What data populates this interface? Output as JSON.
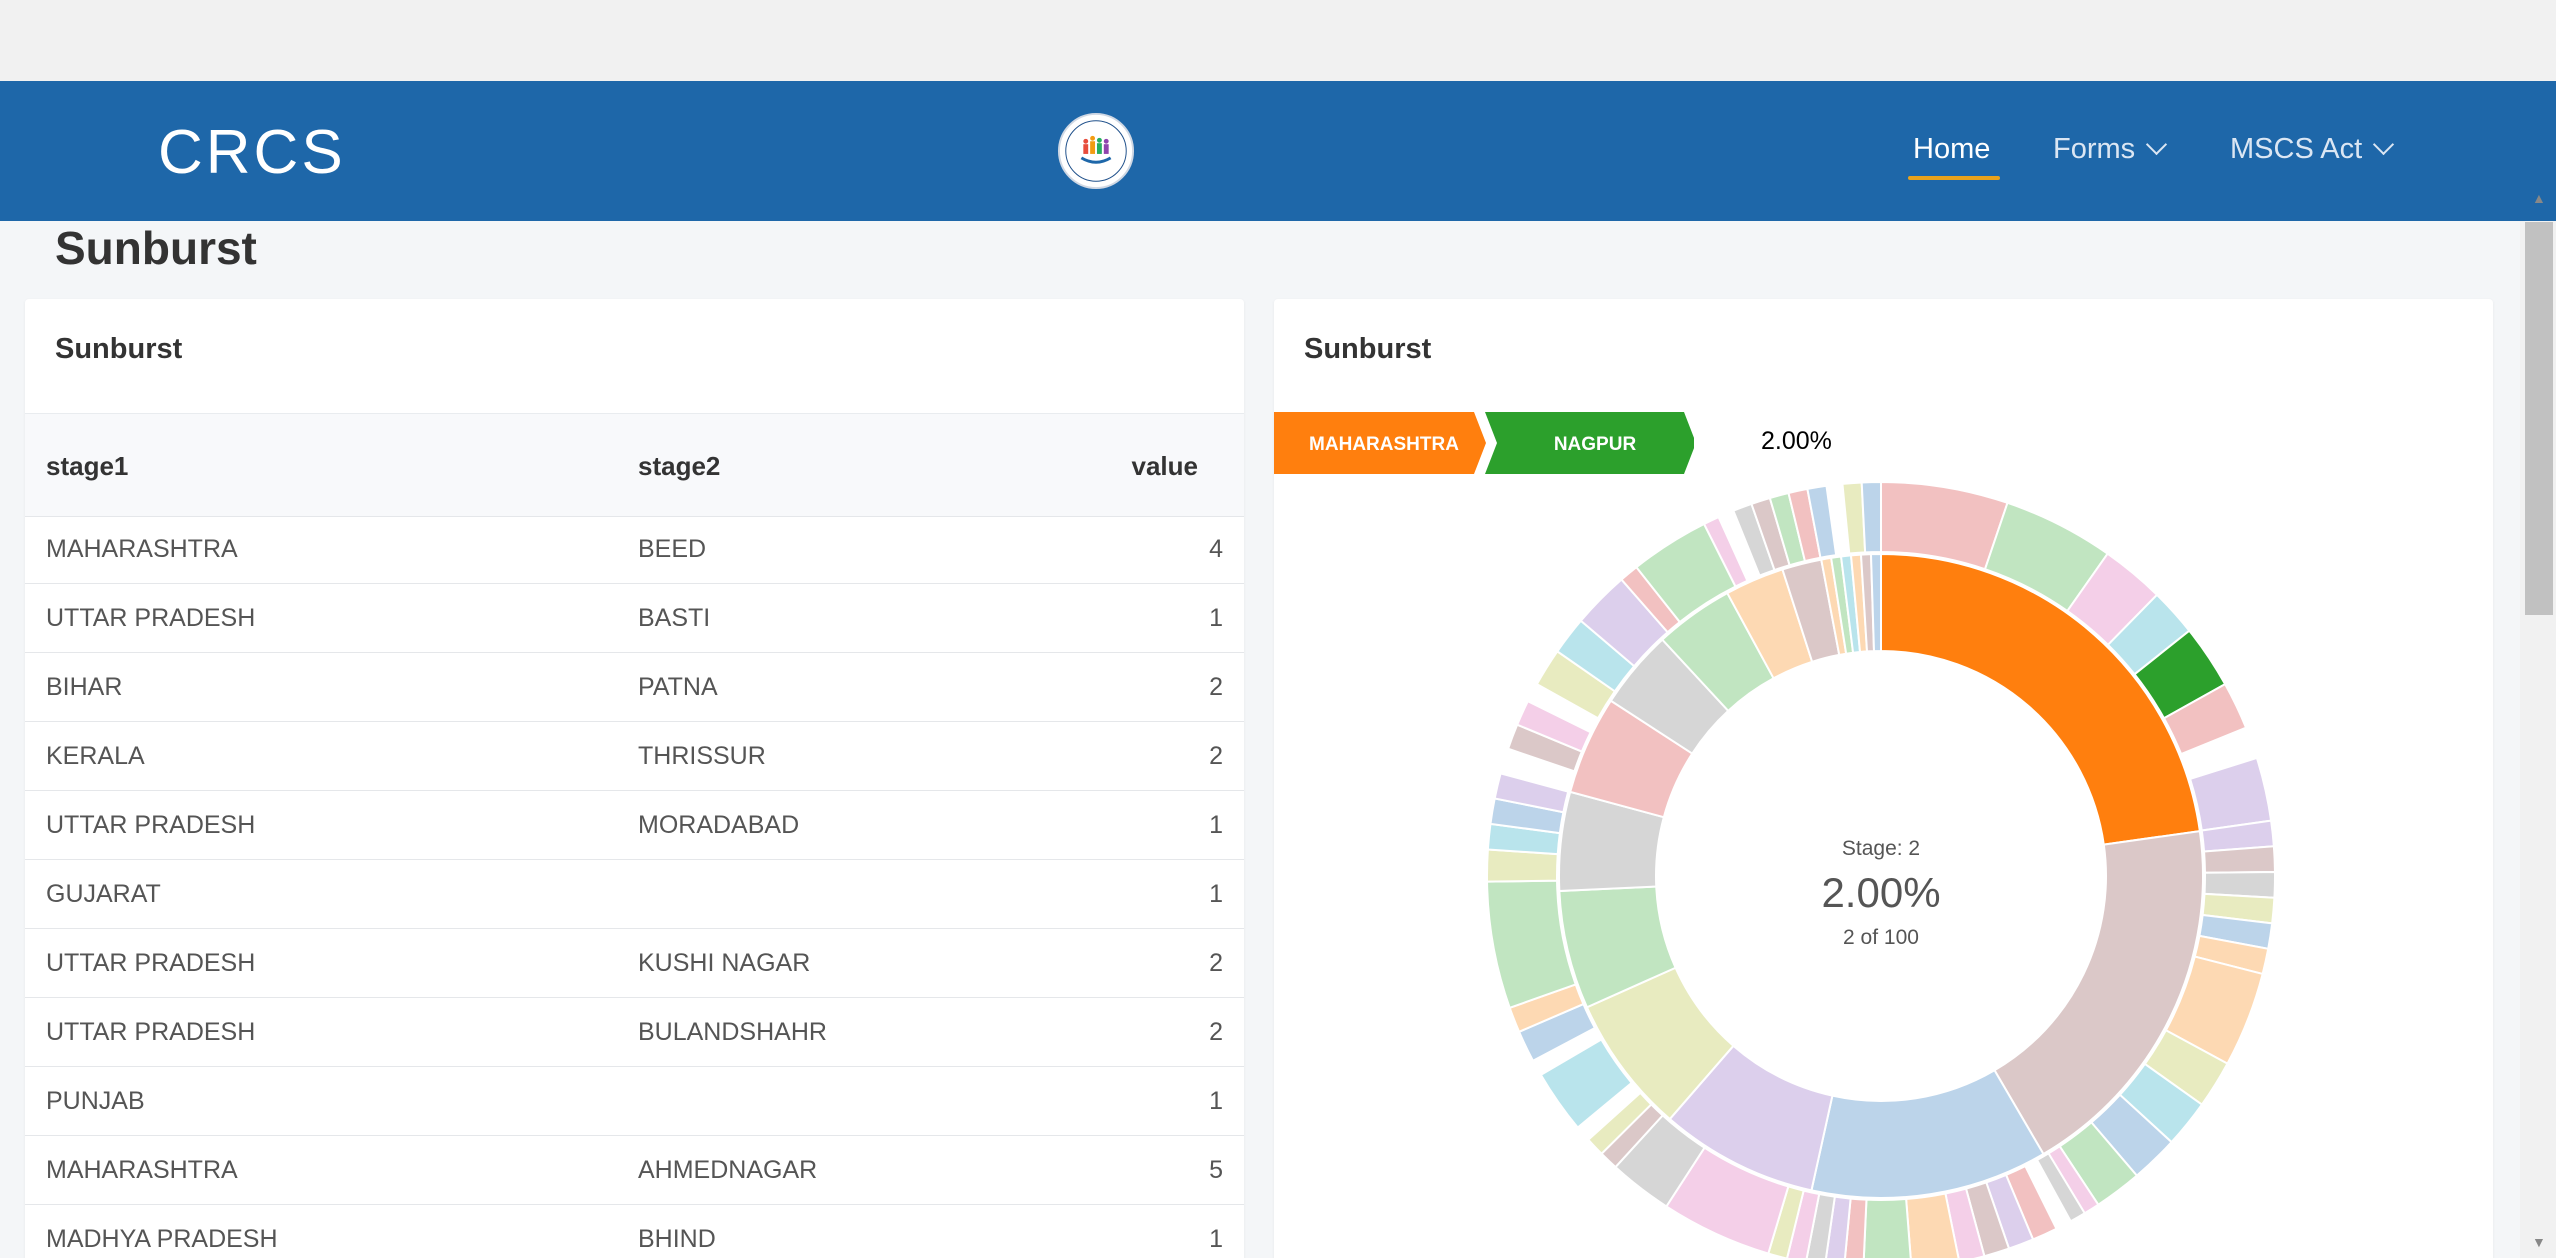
{
  "navbar": {
    "brand": "CRCS",
    "nav_items": [
      {
        "label": "Home",
        "active": true
      },
      {
        "label": "Forms",
        "dropdown": true
      },
      {
        "label": "MSCS Act",
        "dropdown": true
      }
    ]
  },
  "page": {
    "title": "Sunburst"
  },
  "table_card": {
    "title": "Sunburst",
    "columns": [
      "stage1",
      "stage2",
      "value"
    ],
    "rows": [
      [
        "MAHARASHTRA",
        "BEED",
        "4"
      ],
      [
        "UTTAR PRADESH",
        "BASTI",
        "1"
      ],
      [
        "BIHAR",
        "PATNA",
        "2"
      ],
      [
        "KERALA",
        "THRISSUR",
        "2"
      ],
      [
        "UTTAR PRADESH",
        "MORADABAD",
        "1"
      ],
      [
        "GUJARAT",
        "",
        "1"
      ],
      [
        "UTTAR PRADESH",
        "KUSHI NAGAR",
        "2"
      ],
      [
        "UTTAR PRADESH",
        "BULANDSHAHR",
        "2"
      ],
      [
        "PUNJAB",
        "",
        "1"
      ],
      [
        "MAHARASHTRA",
        "AHMEDNAGAR",
        "5"
      ],
      [
        "MADHYA PRADESH",
        "BHIND",
        "1"
      ]
    ]
  },
  "chart_card": {
    "title": "Sunburst",
    "breadcrumb": [
      "MAHARASHTRA",
      "NAGPUR"
    ],
    "breadcrumb_colors": [
      "#ff7f0e",
      "#2ca02c"
    ],
    "percentage": "2.00%",
    "center": {
      "stage": "Stage: 2",
      "percent": "2.00%",
      "count": "2 of 100"
    }
  },
  "chart_data": {
    "type": "sunburst",
    "total": 100,
    "selected": {
      "stage1": "MAHARASHTRA",
      "stage2": "NAGPUR",
      "value": 2
    },
    "inner_ring": [
      {
        "value": 23,
        "color": "#ff7f0e"
      },
      {
        "value": 19,
        "color": "#dbc8c8"
      },
      {
        "value": 12,
        "color": "#bcd4ea"
      },
      {
        "value": 8,
        "color": "#dccfec"
      },
      {
        "value": 7,
        "color": "#e8ebc0"
      },
      {
        "value": 6,
        "color": "#c1e5c1"
      },
      {
        "value": 5,
        "color": "#d6d6d6"
      },
      {
        "value": 5,
        "color": "#f2c1c1"
      },
      {
        "value": 4,
        "color": "#d6d6d6"
      },
      {
        "value": 4,
        "color": "#c1e5c1"
      },
      {
        "value": 3,
        "color": "#fdd9b3"
      },
      {
        "value": 2,
        "color": "#dbc8c8"
      },
      {
        "value": 0.5,
        "color": "#fdd9b3"
      },
      {
        "value": 0.5,
        "color": "#c1e5c1"
      },
      {
        "value": 0.5,
        "color": "#b9e4ec"
      },
      {
        "value": 0.5,
        "color": "#fdd9b3"
      },
      {
        "value": 0.5,
        "color": "#dbc8c8"
      },
      {
        "value": 0.5,
        "color": "#bcd4ea"
      }
    ],
    "outer_ring": [
      {
        "value": 4.0,
        "color": "#f2c1c1"
      },
      {
        "value": 3.5,
        "color": "#c1e5c1"
      },
      {
        "value": 2.0,
        "color": "#f4cfe8"
      },
      {
        "value": 1.5,
        "color": "#b9e4ec"
      },
      {
        "value": 2.0,
        "color": "#2ca02c"
      },
      {
        "value": 1.5,
        "color": "#f2c1c1"
      },
      {
        "value": 1.0,
        "color": null
      },
      {
        "value": 2.0,
        "color": "#dccfec"
      },
      {
        "value": 0.8,
        "color": "#dccfec"
      },
      {
        "value": 0.8,
        "color": "#dbc8c8"
      },
      {
        "value": 0.8,
        "color": "#d6d6d6"
      },
      {
        "value": 0.8,
        "color": "#e8ebc0"
      },
      {
        "value": 0.8,
        "color": "#bcd4ea"
      },
      {
        "value": 0.8,
        "color": "#fdd9b3"
      },
      {
        "value": 3.0,
        "color": "#fdd9b3"
      },
      {
        "value": 1.5,
        "color": "#e8ebc0"
      },
      {
        "value": 1.5,
        "color": "#b9e4ec"
      },
      {
        "value": 1.5,
        "color": "#bcd4ea"
      },
      {
        "value": 1.5,
        "color": "#c1e5c1"
      },
      {
        "value": 0.5,
        "color": "#f4cfe8"
      },
      {
        "value": 0.5,
        "color": "#d6d6d6"
      },
      {
        "value": 0.5,
        "color": null
      },
      {
        "value": 0.8,
        "color": "#f2c1c1"
      },
      {
        "value": 0.8,
        "color": "#dccfec"
      },
      {
        "value": 0.8,
        "color": "#dbc8c8"
      },
      {
        "value": 0.8,
        "color": "#f4cfe8"
      },
      {
        "value": 1.5,
        "color": "#fdd9b3"
      },
      {
        "value": 1.5,
        "color": "#c1e5c1"
      },
      {
        "value": 0.6,
        "color": "#f2c1c1"
      },
      {
        "value": 0.6,
        "color": "#dccfec"
      },
      {
        "value": 0.6,
        "color": "#d6d6d6"
      },
      {
        "value": 0.6,
        "color": "#f4cfe8"
      },
      {
        "value": 0.6,
        "color": "#e8ebc0"
      },
      {
        "value": 3.5,
        "color": "#f4cfe8"
      },
      {
        "value": 2.0,
        "color": "#d6d6d6"
      },
      {
        "value": 0.6,
        "color": "#dbc8c8"
      },
      {
        "value": 0.6,
        "color": "#e8ebc0"
      },
      {
        "value": 0.5,
        "color": null
      },
      {
        "value": 2.0,
        "color": "#b9e4ec"
      },
      {
        "value": 0.5,
        "color": null
      },
      {
        "value": 1.0,
        "color": "#bcd4ea"
      },
      {
        "value": 0.8,
        "color": "#fdd9b3"
      },
      {
        "value": 4.0,
        "color": "#c1e5c1"
      },
      {
        "value": 1.0,
        "color": "#e8ebc0"
      },
      {
        "value": 0.8,
        "color": "#b9e4ec"
      },
      {
        "value": 0.8,
        "color": "#bcd4ea"
      },
      {
        "value": 0.8,
        "color": "#dccfec"
      },
      {
        "value": 0.8,
        "color": null
      },
      {
        "value": 0.8,
        "color": "#dbc8c8"
      },
      {
        "value": 0.8,
        "color": "#f4cfe8"
      },
      {
        "value": 0.6,
        "color": null
      },
      {
        "value": 1.2,
        "color": "#e8ebc0"
      },
      {
        "value": 1.2,
        "color": "#b9e4ec"
      },
      {
        "value": 1.8,
        "color": "#dccfec"
      },
      {
        "value": 0.6,
        "color": "#f2c1c1"
      },
      {
        "value": 2.5,
        "color": "#c1e5c1"
      },
      {
        "value": 0.5,
        "color": "#f4cfe8"
      },
      {
        "value": 0.5,
        "color": null
      },
      {
        "value": 0.6,
        "color": "#d6d6d6"
      },
      {
        "value": 0.6,
        "color": "#dbc8c8"
      },
      {
        "value": 0.6,
        "color": "#c1e5c1"
      },
      {
        "value": 0.6,
        "color": "#f2c1c1"
      },
      {
        "value": 0.6,
        "color": "#bcd4ea"
      },
      {
        "value": 0.5,
        "color": null
      },
      {
        "value": 0.6,
        "color": "#e8ebc0"
      },
      {
        "value": 0.6,
        "color": "#bcd4ea"
      }
    ]
  }
}
